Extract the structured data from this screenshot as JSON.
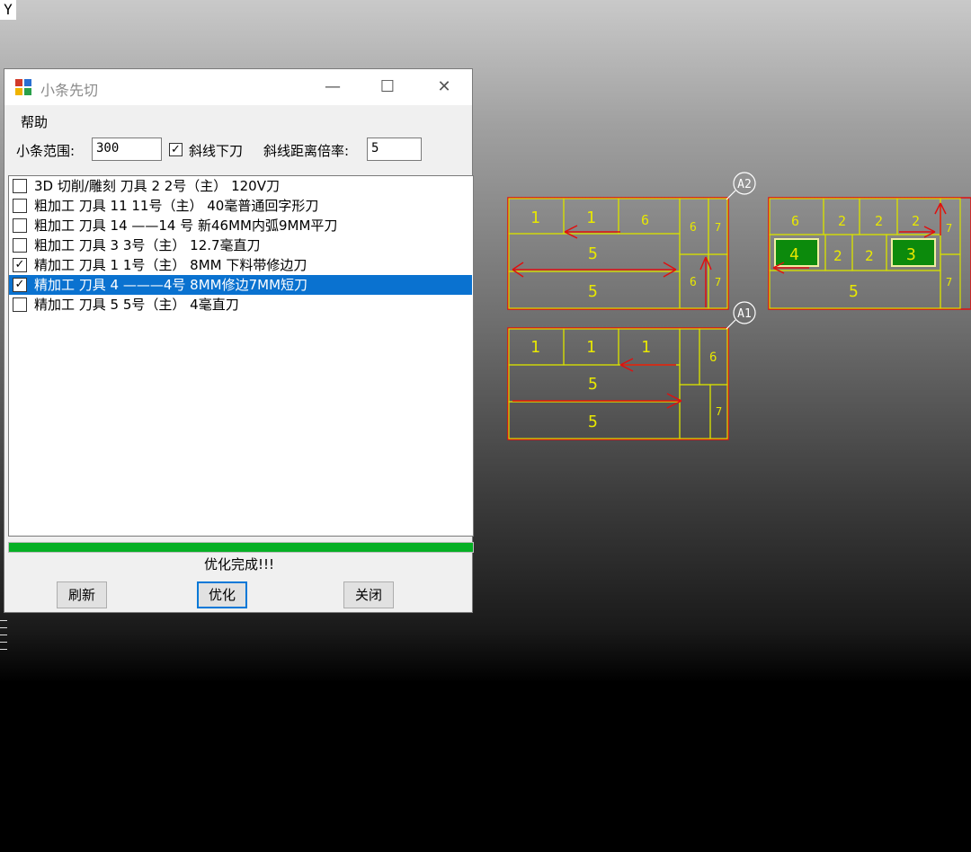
{
  "axis": {
    "y_label": "Y"
  },
  "dialog": {
    "title": "小条先切",
    "menu": {
      "help": "帮助"
    },
    "options": {
      "range_label": "小条范围:",
      "range_value": "300",
      "diag_checkbox_label": "斜线下刀",
      "diag_checked": true,
      "ratio_label": "斜线距离倍率:",
      "ratio_value": "5"
    },
    "tools": [
      {
        "checked": false,
        "selected": false,
        "text": "3D 切削/雕刻    刀具 2   2号（主） 120V刀"
      },
      {
        "checked": false,
        "selected": false,
        "text": "粗加工    刀具 11    11号（主） 40毫普通回字形刀"
      },
      {
        "checked": false,
        "selected": false,
        "text": "粗加工    刀具 14    ——14 号 新46MM内弧9MM平刀"
      },
      {
        "checked": false,
        "selected": false,
        "text": "粗加工    刀具 3    3号（主） 12.7毫直刀"
      },
      {
        "checked": true,
        "selected": false,
        "text": "精加工    刀具 1    1号（主） 8MM 下料带修边刀"
      },
      {
        "checked": true,
        "selected": true,
        "text": "精加工    刀具 4    ———4号 8MM修边7MM短刀"
      },
      {
        "checked": false,
        "selected": false,
        "text": "精加工    刀具 5    5号（主） 4毫直刀"
      }
    ],
    "progress_percent": 100,
    "status_text": "优化完成!!!",
    "buttons": {
      "refresh": "刷新",
      "optimize": "优化",
      "close": "关闭"
    }
  },
  "cad": {
    "sheet_labels": [
      "A2",
      "A1"
    ],
    "part_numbers": [
      "1",
      "2",
      "3",
      "4",
      "5",
      "6",
      "7"
    ],
    "colors": {
      "outline": "#e01010",
      "part_edge": "#d8e000",
      "label": "#e8e800",
      "highlight": "#00c000"
    }
  }
}
